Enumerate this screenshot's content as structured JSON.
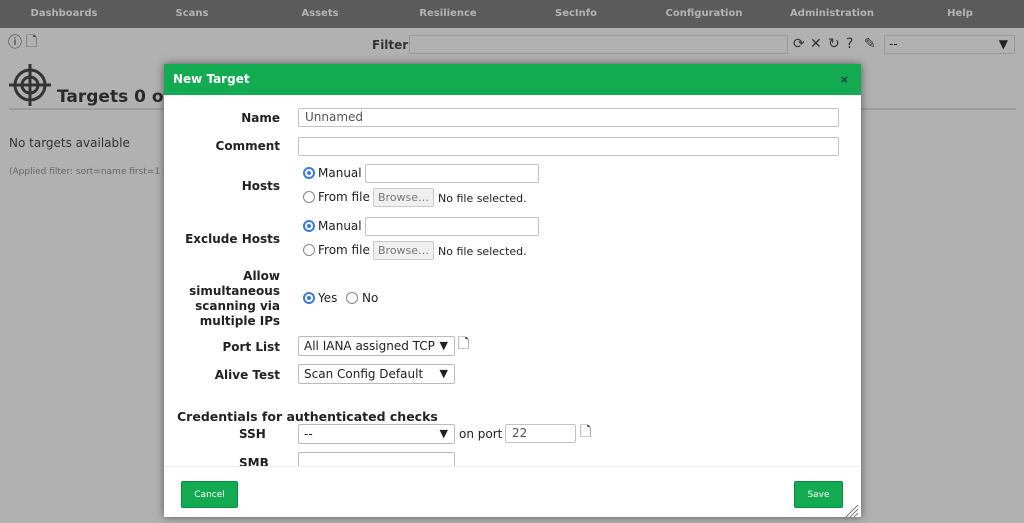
{
  "nav": [
    "Dashboards",
    "Scans",
    "Assets",
    "Resilience",
    "SecInfo",
    "Configuration",
    "Administration",
    "Help"
  ],
  "toolbar": {
    "filter_label": "Filter",
    "filter_value": "",
    "filter_select": "--"
  },
  "page": {
    "title": "Targets 0 of",
    "empty": "No targets available",
    "applied_filter": "(Applied filter: sort=name first=1 r"
  },
  "dialog": {
    "title": "New Target",
    "close": "×",
    "name_label": "Name",
    "name_value": "Unnamed",
    "comment_label": "Comment",
    "comment_value": "",
    "hosts_label": "Hosts",
    "exclude_label": "Exclude Hosts",
    "manual": "Manual",
    "from_file": "From file",
    "browse": "Browse…",
    "no_file": "No file selected.",
    "allow_label": [
      "Allow",
      "simultaneous",
      "scanning via",
      "multiple IPs"
    ],
    "yes": "Yes",
    "no": "No",
    "allow_value": "Yes",
    "port_list_label": "Port List",
    "port_list_value": "All IANA assigned TCP",
    "alive_label": "Alive Test",
    "alive_value": "Scan Config Default",
    "cred_heading": "Credentials for authenticated checks",
    "ssh_label": "SSH",
    "ssh_value": "--",
    "on_port": "on port",
    "ssh_port": "22",
    "smb_label": "SMB",
    "cancel": "Cancel",
    "save": "Save"
  }
}
